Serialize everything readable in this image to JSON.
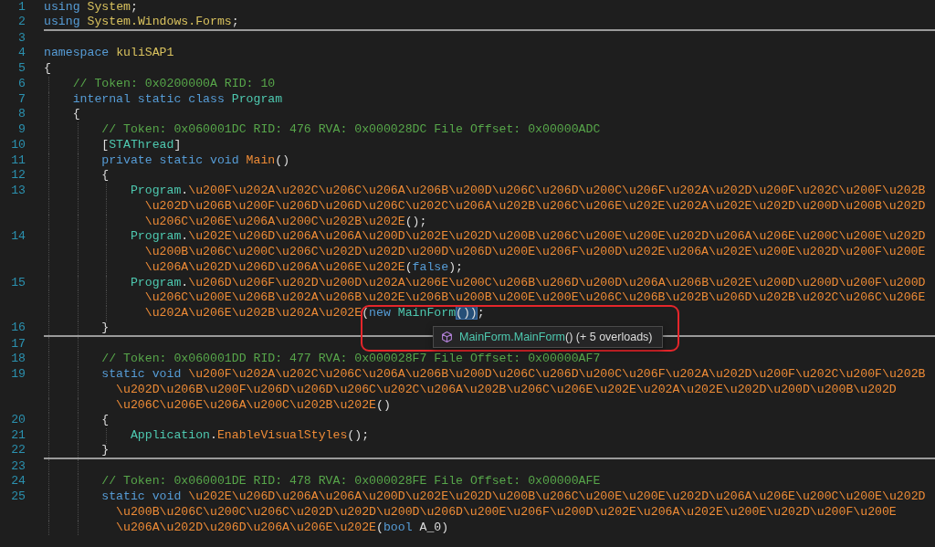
{
  "editor": {
    "lines": [
      {
        "number": "1",
        "separator": false,
        "visual_lines": [
          {
            "segments": [
              {
                "kind": "keyword",
                "text": "using "
              },
              {
                "kind": "namespace",
                "text": "System"
              },
              {
                "kind": "punct",
                "text": ";"
              }
            ]
          }
        ]
      },
      {
        "number": "2",
        "separator": true,
        "visual_lines": [
          {
            "segments": [
              {
                "kind": "keyword",
                "text": "using "
              },
              {
                "kind": "namespace",
                "text": "System.Windows.Forms"
              },
              {
                "kind": "punct",
                "text": ";"
              }
            ]
          }
        ]
      },
      {
        "number": "3",
        "separator": false
      },
      {
        "number": "4",
        "separator": false,
        "visual_lines": [
          {
            "segments": [
              {
                "kind": "keyword",
                "text": "namespace "
              },
              {
                "kind": "namespace",
                "text": "kuliSAP1"
              }
            ]
          }
        ]
      },
      {
        "number": "5",
        "separator": false,
        "visual_lines": [
          {
            "segments": [
              {
                "kind": "punct",
                "text": "{"
              }
            ]
          }
        ],
        "children": [
          {
            "number": "6",
            "separator": false,
            "visual_lines": [
              {
                "segments": [
                  {
                    "kind": "comment",
                    "text": "// Token: 0x0200000A RID: 10"
                  }
                ]
              }
            ]
          },
          {
            "number": "7",
            "separator": false,
            "visual_lines": [
              {
                "segments": [
                  {
                    "kind": "keyword",
                    "text": "internal static class "
                  },
                  {
                    "kind": "type",
                    "text": "Program"
                  }
                ]
              }
            ]
          },
          {
            "number": "8",
            "separator": false,
            "visual_lines": [
              {
                "segments": [
                  {
                    "kind": "punct",
                    "text": "{"
                  }
                ]
              }
            ],
            "children": [
              {
                "number": "9",
                "separator": false,
                "visual_lines": [
                  {
                    "segments": [
                      {
                        "kind": "comment",
                        "text": "// Token: 0x060001DC RID: 476 RVA: 0x000028DC File Offset: 0x00000ADC"
                      }
                    ]
                  }
                ]
              },
              {
                "number": "10",
                "separator": false,
                "visual_lines": [
                  {
                    "segments": [
                      {
                        "kind": "punct",
                        "text": "["
                      },
                      {
                        "kind": "type",
                        "text": "STAThread"
                      },
                      {
                        "kind": "punct",
                        "text": "]"
                      }
                    ]
                  }
                ]
              },
              {
                "number": "11",
                "separator": false,
                "visual_lines": [
                  {
                    "segments": [
                      {
                        "kind": "keyword",
                        "text": "private static void "
                      },
                      {
                        "kind": "method",
                        "text": "Main"
                      },
                      {
                        "kind": "punct",
                        "text": "()"
                      }
                    ]
                  }
                ]
              },
              {
                "number": "12",
                "separator": false,
                "visual_lines": [
                  {
                    "segments": [
                      {
                        "kind": "punct",
                        "text": "{"
                      }
                    ]
                  }
                ],
                "children": [
                  {
                    "number": "13",
                    "separator": false,
                    "visual_lines": [
                      {
                        "segments": [
                          {
                            "kind": "type",
                            "text": "Program"
                          },
                          {
                            "kind": "punct",
                            "text": "."
                          },
                          {
                            "kind": "method",
                            "text": "\\u200F\\u202A\\u202C\\u206C\\u206A\\u206B\\u200D\\u206C\\u206D\\u200C\\u206F\\u202A\\u202D\\u200F\\u202C\\u200F\\u202B"
                          }
                        ]
                      },
                      {
                        "segments": [
                          {
                            "kind": "method",
                            "text": "\\u202D\\u206B\\u200F\\u206D\\u206D\\u206C\\u202C\\u206A\\u202B\\u206C\\u206E\\u202E\\u202A\\u202E\\u202D\\u200D\\u200B\\u202D"
                          }
                        ]
                      },
                      {
                        "segments": [
                          {
                            "kind": "method",
                            "text": "\\u206C\\u206E\\u206A\\u200C\\u202B\\u202E"
                          },
                          {
                            "kind": "punct",
                            "text": "();"
                          }
                        ]
                      }
                    ]
                  },
                  {
                    "number": "14",
                    "separator": false,
                    "visual_lines": [
                      {
                        "segments": [
                          {
                            "kind": "type",
                            "text": "Program"
                          },
                          {
                            "kind": "punct",
                            "text": "."
                          },
                          {
                            "kind": "method",
                            "text": "\\u202E\\u206D\\u206A\\u206A\\u200D\\u202E\\u202D\\u200B\\u206C\\u200E\\u200E\\u202D\\u206A\\u206E\\u200C\\u200E\\u202D"
                          }
                        ]
                      },
                      {
                        "segments": [
                          {
                            "kind": "method",
                            "text": "\\u200B\\u206C\\u200C\\u206C\\u202D\\u202D\\u200D\\u206D\\u200E\\u206F\\u200D\\u202E\\u206A\\u202E\\u200E\\u202D\\u200F\\u200E"
                          }
                        ]
                      },
                      {
                        "segments": [
                          {
                            "kind": "method",
                            "text": "\\u206A\\u202D\\u206D\\u206A\\u206E\\u202E"
                          },
                          {
                            "kind": "punct",
                            "text": "("
                          },
                          {
                            "kind": "keyword",
                            "text": "false"
                          },
                          {
                            "kind": "punct",
                            "text": ");"
                          }
                        ]
                      }
                    ]
                  },
                  {
                    "number": "15",
                    "separator": false,
                    "visual_lines": [
                      {
                        "segments": [
                          {
                            "kind": "type",
                            "text": "Program"
                          },
                          {
                            "kind": "punct",
                            "text": "."
                          },
                          {
                            "kind": "method",
                            "text": "\\u206D\\u206F\\u202D\\u200D\\u202A\\u206E\\u200C\\u206B\\u206D\\u200D\\u206A\\u206B\\u202E\\u200D\\u200D\\u200F\\u200D"
                          }
                        ]
                      },
                      {
                        "segments": [
                          {
                            "kind": "method",
                            "text": "\\u206C\\u200E\\u206B\\u202A\\u206B\\u202E\\u206B\\u200B\\u200E\\u200E\\u206C\\u206B\\u202B\\u206D\\u202B\\u202C\\u206C\\u206E"
                          }
                        ]
                      },
                      {
                        "segments": [
                          {
                            "kind": "method",
                            "text": "\\u202A\\u206E\\u202B\\u202A\\u202E"
                          },
                          {
                            "kind": "punct",
                            "text": "("
                          },
                          {
                            "kind": "keyword",
                            "text": "new "
                          },
                          {
                            "kind": "type",
                            "text": "MainForm"
                          },
                          {
                            "kind": "selection",
                            "text": "())"
                          },
                          {
                            "kind": "punct",
                            "text": ";"
                          }
                        ]
                      }
                    ]
                  }
                ]
              },
              {
                "number": "16",
                "separator": true,
                "visual_lines": [
                  {
                    "segments": [
                      {
                        "kind": "punct",
                        "text": "}"
                      }
                    ]
                  }
                ]
              },
              {
                "number": "17",
                "separator": false
              },
              {
                "number": "18",
                "separator": false,
                "visual_lines": [
                  {
                    "segments": [
                      {
                        "kind": "comment",
                        "text": "// Token: 0x060001DD RID: 477 RVA: 0x000028F7 File Offset: 0x00000AF7"
                      }
                    ]
                  }
                ]
              },
              {
                "number": "19",
                "separator": false,
                "visual_lines": [
                  {
                    "segments": [
                      {
                        "kind": "keyword",
                        "text": "static void "
                      },
                      {
                        "kind": "method",
                        "text": "\\u200F\\u202A\\u202C\\u206C\\u206A\\u206B\\u200D\\u206C\\u206D\\u200C\\u206F\\u202A\\u202D\\u200F\\u202C\\u200F\\u202B"
                      }
                    ]
                  },
                  {
                    "segments": [
                      {
                        "kind": "method",
                        "text": "\\u202D\\u206B\\u200F\\u206D\\u206D\\u206C\\u202C\\u206A\\u202B\\u206C\\u206E\\u202E\\u202A\\u202E\\u202D\\u200D\\u200B\\u202D"
                      }
                    ]
                  },
                  {
                    "segments": [
                      {
                        "kind": "method",
                        "text": "\\u206C\\u206E\\u206A\\u200C\\u202B\\u202E"
                      },
                      {
                        "kind": "punct",
                        "text": "()"
                      }
                    ]
                  }
                ]
              },
              {
                "number": "20",
                "separator": false,
                "visual_lines": [
                  {
                    "segments": [
                      {
                        "kind": "punct",
                        "text": "{"
                      }
                    ]
                  }
                ],
                "children": [
                  {
                    "number": "21",
                    "separator": false,
                    "visual_lines": [
                      {
                        "segments": [
                          {
                            "kind": "type",
                            "text": "Application"
                          },
                          {
                            "kind": "punct",
                            "text": "."
                          },
                          {
                            "kind": "method",
                            "text": "EnableVisualStyles"
                          },
                          {
                            "kind": "punct",
                            "text": "();"
                          }
                        ]
                      }
                    ]
                  }
                ]
              },
              {
                "number": "22",
                "separator": true,
                "visual_lines": [
                  {
                    "segments": [
                      {
                        "kind": "punct",
                        "text": "}"
                      }
                    ]
                  }
                ]
              },
              {
                "number": "23",
                "separator": false
              },
              {
                "number": "24",
                "separator": false,
                "visual_lines": [
                  {
                    "segments": [
                      {
                        "kind": "comment",
                        "text": "// Token: 0x060001DE RID: 478 RVA: 0x000028FE File Offset: 0x00000AFE"
                      }
                    ]
                  }
                ]
              },
              {
                "number": "25",
                "separator": false,
                "visual_lines": [
                  {
                    "segments": [
                      {
                        "kind": "keyword",
                        "text": "static void "
                      },
                      {
                        "kind": "method",
                        "text": "\\u202E\\u206D\\u206A\\u206A\\u200D\\u202E\\u202D\\u200B\\u206C\\u200E\\u200E\\u202D\\u206A\\u206E\\u200C\\u200E\\u202D"
                      }
                    ]
                  },
                  {
                    "segments": [
                      {
                        "kind": "method",
                        "text": "\\u200B\\u206C\\u200C\\u206C\\u202D\\u202D\\u200D\\u206D\\u200E\\u206F\\u200D\\u202E\\u206A\\u202E\\u200E\\u202D\\u200F\\u200E"
                      }
                    ]
                  },
                  {
                    "segments": [
                      {
                        "kind": "method",
                        "text": "\\u206A\\u202D\\u206D\\u206A\\u206E\\u202E"
                      },
                      {
                        "kind": "punct",
                        "text": "("
                      },
                      {
                        "kind": "keyword",
                        "text": "bool"
                      },
                      {
                        "kind": "plain",
                        "text": " A_0"
                      },
                      {
                        "kind": "punct",
                        "text": ")"
                      }
                    ]
                  }
                ]
              }
            ]
          }
        ]
      }
    ]
  },
  "tooltip": {
    "segments": [
      {
        "kind": "type",
        "text": "MainForm.MainForm"
      },
      {
        "kind": "punct",
        "text": "()"
      },
      {
        "kind": "plain",
        "text": " (+ 5 overloads)"
      }
    ]
  },
  "callout_frame": true
}
